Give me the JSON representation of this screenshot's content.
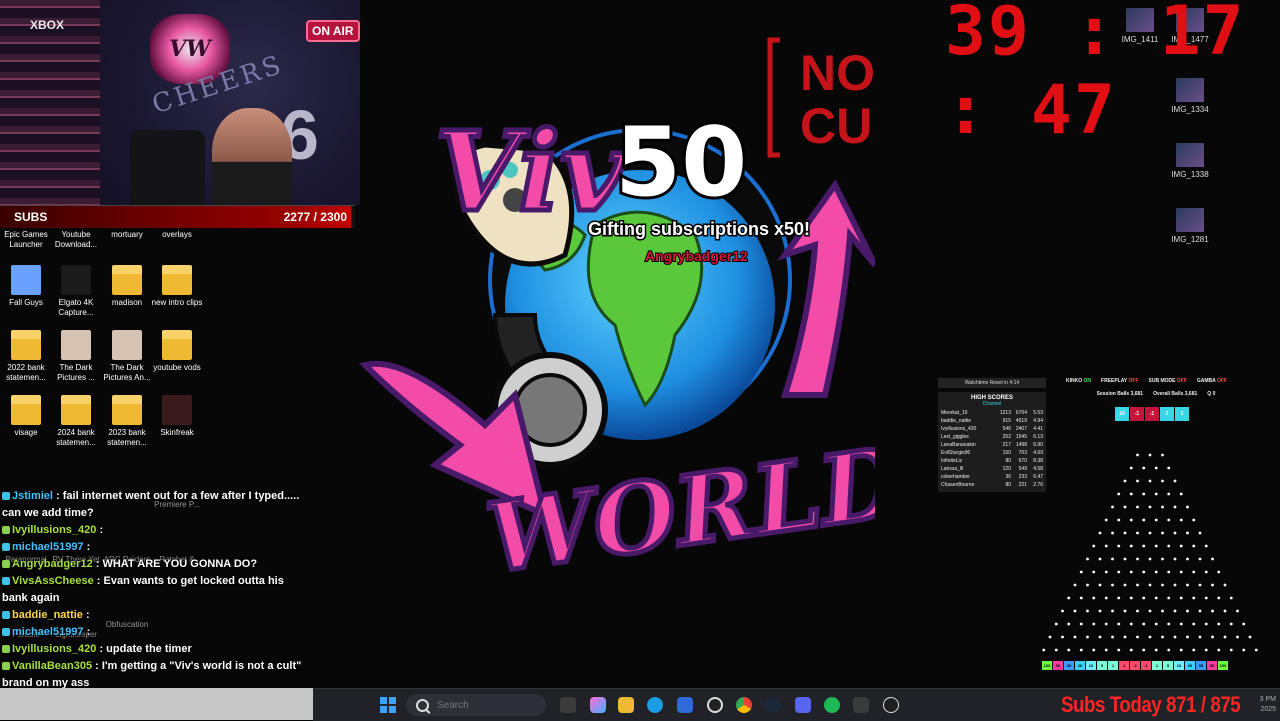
{
  "webcam": {
    "xbox": "XBOX",
    "on_air": "ON AIR",
    "logo": "VW",
    "cheers": "CHEERS",
    "balloon": "6"
  },
  "subs_goal": {
    "label": "SUBS",
    "current": 2277,
    "goal": 2300,
    "count_text": "2277 / 2300"
  },
  "timer": "39 : 17 : 47",
  "desktop_icons": [
    {
      "label": "Epic Games Launcher",
      "icon": "epic-games-icon",
      "color": "#2a2a2a"
    },
    {
      "label": "Youtube Download...",
      "icon": "youtube-download-icon",
      "color": "#c4302b"
    },
    {
      "label": "mortuary",
      "icon": "folder-icon",
      "color": "#f0b933"
    },
    {
      "label": "overlays",
      "icon": "folder-icon",
      "color": "#f0b933"
    },
    {
      "label": "Fall Guys",
      "icon": "fall-guys-icon",
      "color": "#6aa0ff"
    },
    {
      "label": "Elgato 4K Capture...",
      "icon": "elgato-4k-icon",
      "color": "#1b1b1b"
    },
    {
      "label": "madison",
      "icon": "folder-icon",
      "color": "#f0b933"
    },
    {
      "label": "new intro clips",
      "icon": "folder-icon",
      "color": "#f0b933"
    },
    {
      "label": "2022 bank statemen...",
      "icon": "folder-icon",
      "color": "#f0b933"
    },
    {
      "label": "The Dark Pictures ...",
      "icon": "dark-pictures-icon",
      "color": "#d6c3b4"
    },
    {
      "label": "The Dark Pictures An...",
      "icon": "dark-pictures-icon",
      "color": "#d6c3b4"
    },
    {
      "label": "youtube vods",
      "icon": "folder-icon",
      "color": "#f0b933"
    },
    {
      "label": "visage",
      "icon": "folder-icon",
      "color": "#f0b933"
    },
    {
      "label": "2024 bank statemen...",
      "icon": "folder-icon",
      "color": "#f0b933"
    },
    {
      "label": "2023 bank statemen...",
      "icon": "folder-icon",
      "color": "#f0b933"
    },
    {
      "label": "Skinfreak",
      "icon": "skinfreak-icon",
      "color": "#3a1a1a"
    }
  ],
  "partial_icons": [
    {
      "label": "Paranormal",
      "icon": "paranormal-icon"
    },
    {
      "label": "RV There Yet",
      "icon": "rv-there-yet-icon"
    },
    {
      "label": "ARC Raiders",
      "icon": "arc-raiders-icon"
    },
    {
      "label": "Ratchet &",
      "icon": "ratchet-icon"
    },
    {
      "label": "Premiere P...",
      "icon": "premiere-pro-icon"
    },
    {
      "label": "Parable",
      "icon": "parable-icon"
    },
    {
      "label": "Lightkeeper",
      "icon": "lightkeeper-icon"
    },
    {
      "label": "Obfuscation",
      "icon": "obfuscation-icon"
    }
  ],
  "right_icons": [
    {
      "label": "IMG_1411"
    },
    {
      "label": "IMG_1477"
    },
    {
      "label": "IMG_1334"
    },
    {
      "label": "IMG_1338"
    },
    {
      "label": "IMG_1281"
    }
  ],
  "art": {
    "not_a_cult_line1": "NOT A",
    "not_a_cult_line2": "CULT",
    "gift_count": "50",
    "gift_text": "Gifting subscriptions x50!",
    "gifter": "Angrybadger12",
    "world_text": "WORLD",
    "viv_text": "Viv"
  },
  "high_scores": {
    "header": "Watchtime Reset in 4:14",
    "title": "HIGH SCORES",
    "channel": "Channel",
    "rows": [
      [
        "Meerkat_19",
        "1213",
        "6704",
        "5.53"
      ],
      [
        "baddie_nattie",
        "915",
        "4519",
        "4.94"
      ],
      [
        "Ivyillusions_420",
        "546",
        "2407",
        "4.41"
      ],
      [
        "Lexi_giggles",
        "252",
        "1545",
        "6.13"
      ],
      [
        "LanaBananakin",
        "217",
        "1498",
        "6.90"
      ],
      [
        "EvilSturgis96",
        "150",
        "703",
        "4.69"
      ],
      [
        "InfiniteLiz",
        "80",
        "670",
        "8.38"
      ],
      [
        "Larissa_lil",
        "120",
        "549",
        "4.58"
      ],
      [
        "coleehamber",
        "36",
        "233",
        "6.47"
      ],
      [
        "ChasenBourne",
        "80",
        "221",
        "2.76"
      ]
    ]
  },
  "status": {
    "kinko_label": "KINKO",
    "kinko_value": "ON",
    "freeplay_label": "FREEPLAY",
    "freeplay_value": "OFF",
    "submode_label": "SUB MODE",
    "submode_value": "OFF",
    "gamba_label": "GAMBA",
    "gamba_value": "OFF",
    "session_balls_label": "Session Balls",
    "session_balls": "3,681",
    "overall_balls_label": "Overall Balls",
    "overall_balls": "3,681",
    "queue_label": "Q",
    "queue": "0"
  },
  "slots": [
    {
      "text": "10",
      "color": "#38d6e6"
    },
    {
      "text": "-1",
      "color": "#c4143a"
    },
    {
      "text": "-1",
      "color": "#c4143a"
    },
    {
      "text": "1",
      "color": "#38d6e6"
    },
    {
      "text": "1",
      "color": "#38d6e6"
    }
  ],
  "plinko_bins": [
    {
      "text": "100",
      "color": "#6cff3a"
    },
    {
      "text": "50",
      "color": "#ff3aa0"
    },
    {
      "text": "35",
      "color": "#3a9cff"
    },
    {
      "text": "20",
      "color": "#3ad0ff"
    },
    {
      "text": "10",
      "color": "#6cf0ff"
    },
    {
      "text": "5",
      "color": "#7affd6"
    },
    {
      "text": "1",
      "color": "#7affd6"
    },
    {
      "text": "-1",
      "color": "#ff4a6a"
    },
    {
      "text": "-2",
      "color": "#ff4a6a"
    },
    {
      "text": "-1",
      "color": "#ff4a6a"
    },
    {
      "text": "1",
      "color": "#7affd6"
    },
    {
      "text": "5",
      "color": "#7affd6"
    },
    {
      "text": "10",
      "color": "#6cf0ff"
    },
    {
      "text": "20",
      "color": "#3ad0ff"
    },
    {
      "text": "35",
      "color": "#3a9cff"
    },
    {
      "text": "50",
      "color": "#ff3aa0"
    },
    {
      "text": "100",
      "color": "#6cff3a"
    }
  ],
  "chat": [
    {
      "user": "Jstimiel",
      "color": "#3ec3ff",
      "message": ": fail internet went out for a few after I typed..... can we add time?",
      "badge": "b"
    },
    {
      "user": "Ivyillusions_420",
      "color": "#a9e23c",
      "message": ":",
      "badge": "g"
    },
    {
      "user": "michael51997",
      "color": "#3ec3ff",
      "message": ":",
      "badge": "b"
    },
    {
      "user": "Angrybadger12",
      "color": "#a9e23c",
      "message": ": WHAT ARE YOU GONNA DO?",
      "badge": "g"
    },
    {
      "user": "VivsAssCheese",
      "color": "#a9e23c",
      "message": ": Evan wants to get locked outta his bank again",
      "badge": "b"
    },
    {
      "user": "baddie_nattie",
      "color": "#ffd84a",
      "message": ":",
      "badge": "b"
    },
    {
      "user": "michael51997",
      "color": "#3ec3ff",
      "message": ":",
      "badge": "b"
    },
    {
      "user": "Ivyillusions_420",
      "color": "#a9e23c",
      "message": ": update the timer",
      "badge": "g"
    },
    {
      "user": "VanillaBean305",
      "color": "#a9e23c",
      "message": ": I'm getting a \"Viv's world is not a cult\" brand on my ass",
      "badge": "g"
    }
  ],
  "taskbar": {
    "search_placeholder": "Search",
    "subs_today": "Subs Today  871 / 875",
    "clock_time": "3 PM",
    "clock_date": "2025"
  }
}
